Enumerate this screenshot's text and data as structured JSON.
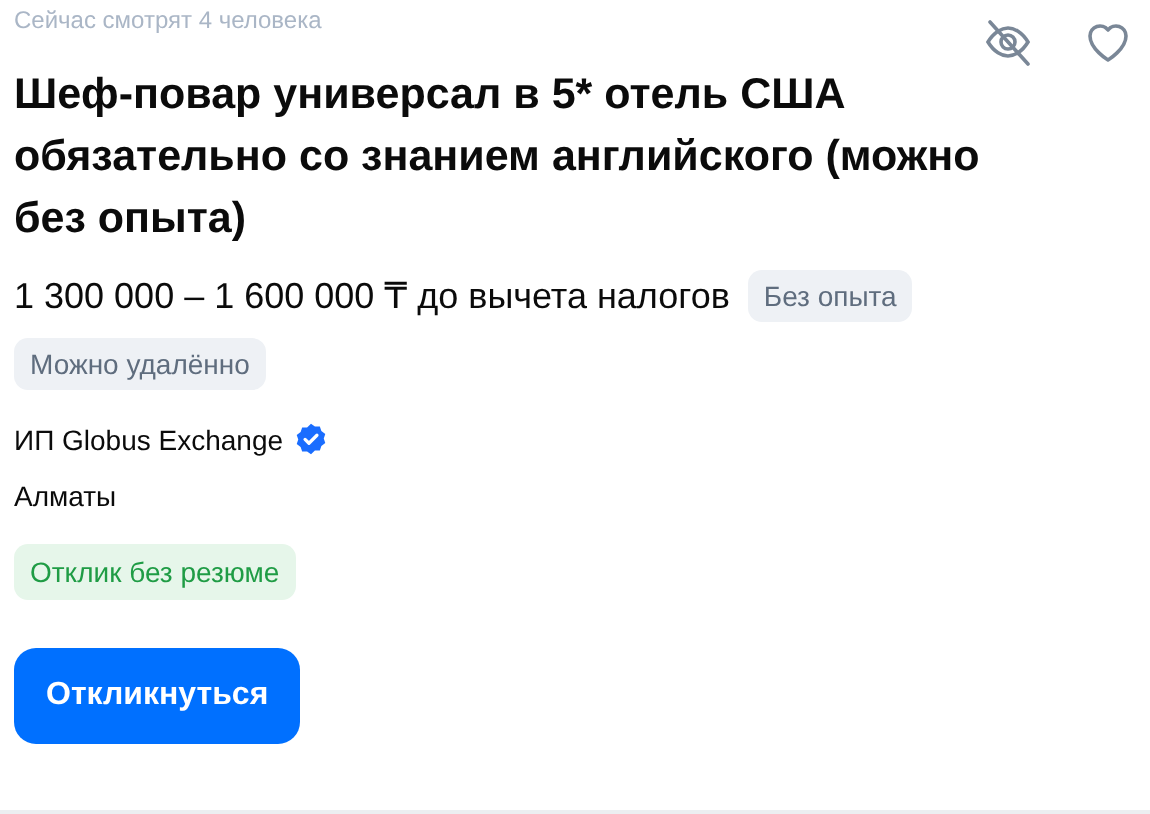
{
  "viewers": "Сейчас смотрят 4 человека",
  "title": "Шеф-повар универсал в 5* отель США обязательно со знанием английского (можно без опыта)",
  "salary": "1 300 000 – 1 600 000 ₸ до вычета налогов",
  "salary_tag": "Без опыта",
  "tags": [
    "Можно удалённо"
  ],
  "company": {
    "name": "ИП Globus Exchange",
    "verified": true
  },
  "city": "Алматы",
  "response_badge": "Отклик без резюме",
  "apply_button": "Откликнуться"
}
